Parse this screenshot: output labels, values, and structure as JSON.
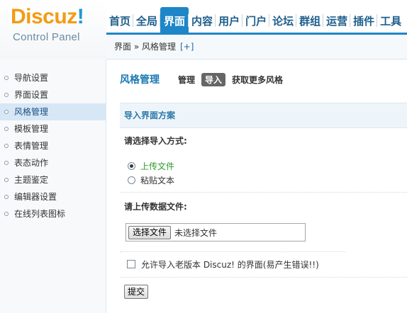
{
  "logo": {
    "main_part1": "Discuz",
    "main_part2": "!",
    "subtitle": "Control Panel"
  },
  "topnav": {
    "items": [
      {
        "label": "首页"
      },
      {
        "label": "全局"
      },
      {
        "label": "界面",
        "active": true
      },
      {
        "label": "内容"
      },
      {
        "label": "用户"
      },
      {
        "label": "门户"
      },
      {
        "label": "论坛"
      },
      {
        "label": "群组"
      },
      {
        "label": "运营"
      },
      {
        "label": "插件"
      },
      {
        "label": "工具"
      }
    ]
  },
  "breadcrumb": {
    "text": "界面 » 风格管理",
    "add": "[+]"
  },
  "sidebar": {
    "items": [
      {
        "label": "导航设置"
      },
      {
        "label": "界面设置"
      },
      {
        "label": "风格管理",
        "active": true
      },
      {
        "label": "模板管理"
      },
      {
        "label": "表情管理"
      },
      {
        "label": "表态动作"
      },
      {
        "label": "主题鉴定"
      },
      {
        "label": "编辑器设置"
      },
      {
        "label": "在线列表图标"
      }
    ]
  },
  "main": {
    "title": "风格管理",
    "tabs": [
      {
        "label": "管理"
      },
      {
        "label": "导入",
        "active": true
      },
      {
        "label": "获取更多风格"
      }
    ],
    "section_title": "导入界面方案",
    "method_label": "请选择导入方式:",
    "radio_upload": "上传文件",
    "radio_paste": "粘贴文本",
    "file_label": "请上传数据文件:",
    "file_button": "选择文件",
    "file_status": "未选择文件",
    "compat_label": "允许导入老版本 Discuz! 的界面(易产生错误!!)",
    "submit": "提交"
  },
  "colors": {
    "accent_blue": "#1e86c8",
    "logo_orange": "#f39b12",
    "active_green": "#2b9a2b"
  }
}
